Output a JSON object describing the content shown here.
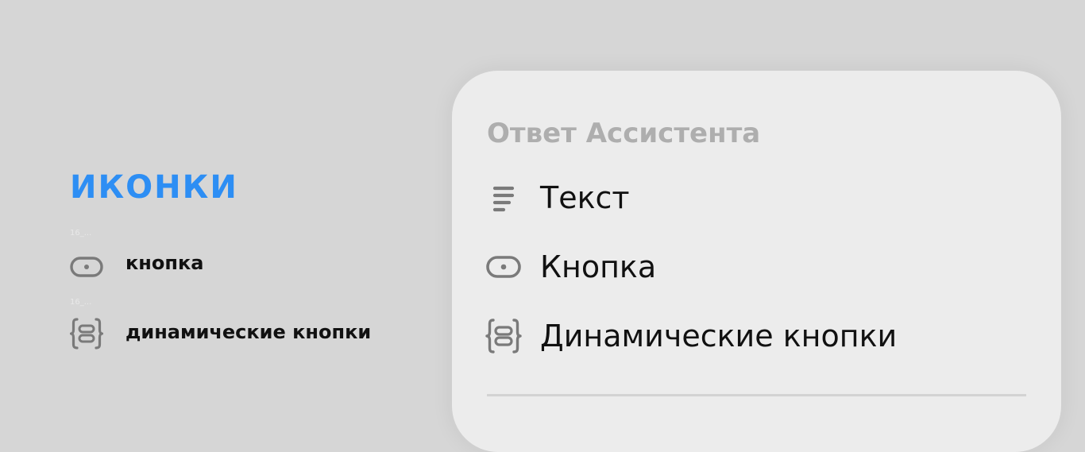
{
  "legend": {
    "title": "ИКОНКИ",
    "items": [
      {
        "tag": "16_...",
        "icon": "button-icon",
        "label": "кнопка"
      },
      {
        "tag": "16_...",
        "icon": "dynamic-buttons-icon",
        "label": "динамические кнопки"
      }
    ]
  },
  "card": {
    "heading": "Ответ Ассистента",
    "options": [
      {
        "icon": "text-icon",
        "label": "Текст"
      },
      {
        "icon": "button-icon",
        "label": "Кнопка"
      },
      {
        "icon": "dynamic-buttons-icon",
        "label": "Динамические кнопки"
      }
    ]
  },
  "colors": {
    "background": "#d6d6d6",
    "card": "#ececec",
    "accent": "#2d8ef4",
    "heading_muted": "#aeaeae",
    "icon": "#7a7a7a",
    "text": "#111111"
  }
}
